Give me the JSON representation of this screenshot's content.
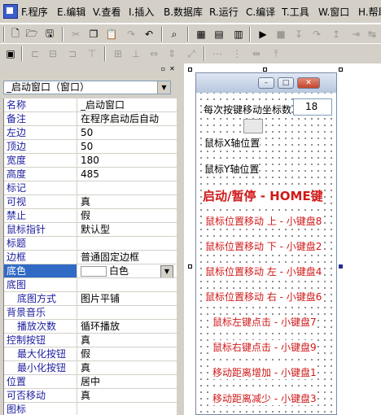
{
  "menu": [
    "F.程序",
    "E.编辑",
    "V.查看",
    "I.插入",
    "B.数据库",
    "R.运行",
    "C.编译",
    "T.工具",
    "W.窗口",
    "H.帮助"
  ],
  "toolbar1_icons": [
    "new-file-icon",
    "open-file-icon",
    "save-icon",
    "cut-icon",
    "copy-icon",
    "paste-icon",
    "redo-icon",
    "undo-icon",
    "find-icon",
    "layout-single-icon",
    "layout-split-icon",
    "layout-list-icon",
    "run-icon",
    "stop-icon",
    "debug-step-into-icon",
    "debug-step-over-icon",
    "debug-step-out-icon",
    "debug-run-to-icon"
  ],
  "toolbar2_icons": [
    "properties-icon",
    "align-left-icon",
    "align-center-v-icon",
    "align-right-icon",
    "align-top-icon",
    "align-middle-icon",
    "align-bottom-icon",
    "same-width-icon",
    "same-height-icon",
    "same-size-icon",
    "space-h-icon",
    "space-v-icon",
    "center-h-icon",
    "center-v-icon"
  ],
  "pane": {
    "selector_value": "_启动窗口（窗口）",
    "properties": [
      {
        "name": "名称",
        "value": "_启动窗口"
      },
      {
        "name": "备注",
        "value": "在程序启动后自动"
      },
      {
        "name": "左边",
        "value": "50"
      },
      {
        "name": "顶边",
        "value": "50"
      },
      {
        "name": "宽度",
        "value": "180"
      },
      {
        "name": "高度",
        "value": "485"
      },
      {
        "name": "标记",
        "value": ""
      },
      {
        "name": "可视",
        "value": "真"
      },
      {
        "name": "禁止",
        "value": "假"
      },
      {
        "name": "鼠标指针",
        "value": "默认型"
      },
      {
        "name": "标题",
        "value": ""
      },
      {
        "name": "边框",
        "value": "普通固定边框"
      },
      {
        "name": "底色",
        "value": "白色",
        "selected": true
      },
      {
        "name": "底图",
        "value": ""
      },
      {
        "name": "底图方式",
        "value": "图片平铺",
        "sub": true
      },
      {
        "name": "背景音乐",
        "value": ""
      },
      {
        "name": "播放次数",
        "value": "循环播放",
        "sub": true
      },
      {
        "name": "控制按钮",
        "value": "真"
      },
      {
        "name": "最大化按钮",
        "value": "假",
        "sub": true
      },
      {
        "name": "最小化按钮",
        "value": "真",
        "sub": true
      },
      {
        "name": "位置",
        "value": "居中"
      },
      {
        "name": "可否移动",
        "value": "真"
      },
      {
        "name": "图标",
        "value": ""
      }
    ]
  },
  "form": {
    "step_label": "每次按键移动坐标数",
    "step_value": "18",
    "mouse_x_label": "鼠标X轴位置",
    "mouse_y_label": "鼠标Y轴位置",
    "hotkey_title": "启动/暂停 - HOME键",
    "lines": [
      "鼠标位置移动 上 - 小键盘8",
      "鼠标位置移动 下 - 小键盘2",
      "鼠标位置移动 左 - 小键盘4",
      "鼠标位置移动 右 - 小键盘6",
      "鼠标左键点击 - 小键盘7",
      "鼠标右键点击 - 小键盘9",
      "移动距离增加 - 小键盘1",
      "移动距离减少 - 小键盘3"
    ]
  },
  "colors": {
    "accent_red": "#d01818",
    "selection": "#316ac5",
    "property_name": "#2020a0"
  }
}
